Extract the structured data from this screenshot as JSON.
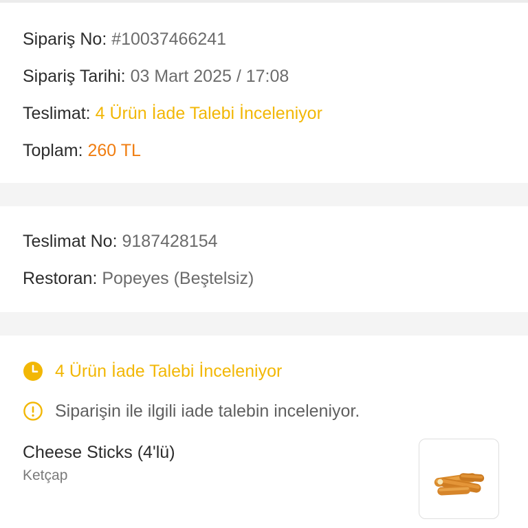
{
  "order": {
    "order_no_label": "Sipariş No:",
    "order_no_value": "#10037466241",
    "order_date_label": "Sipariş Tarihi:",
    "order_date_value": "03 Mart 2025 / 17:08",
    "delivery_label": "Teslimat:",
    "delivery_status": "4 Ürün İade Talebi İnceleniyor",
    "total_label": "Toplam:",
    "total_value": "260 TL"
  },
  "delivery": {
    "delivery_no_label": "Teslimat No:",
    "delivery_no_value": "9187428154",
    "restaurant_label": "Restoran:",
    "restaurant_value": "Popeyes (Beştelsiz)"
  },
  "items_section": {
    "status_title": "4 Ürün İade Talebi İnceleniyor",
    "info_text": "Siparişin ile ilgili iade talebin inceleniyor.",
    "product": {
      "name": "Cheese Sticks (4'lü)",
      "option": "Ketçap",
      "image_icon": "cheese-sticks-image"
    }
  },
  "colors": {
    "status_yellow": "#f2b705",
    "total_orange": "#f07d10",
    "label_dark": "#2c2c2c",
    "value_gray": "#6b6b6b",
    "background": "#f4f4f4"
  }
}
